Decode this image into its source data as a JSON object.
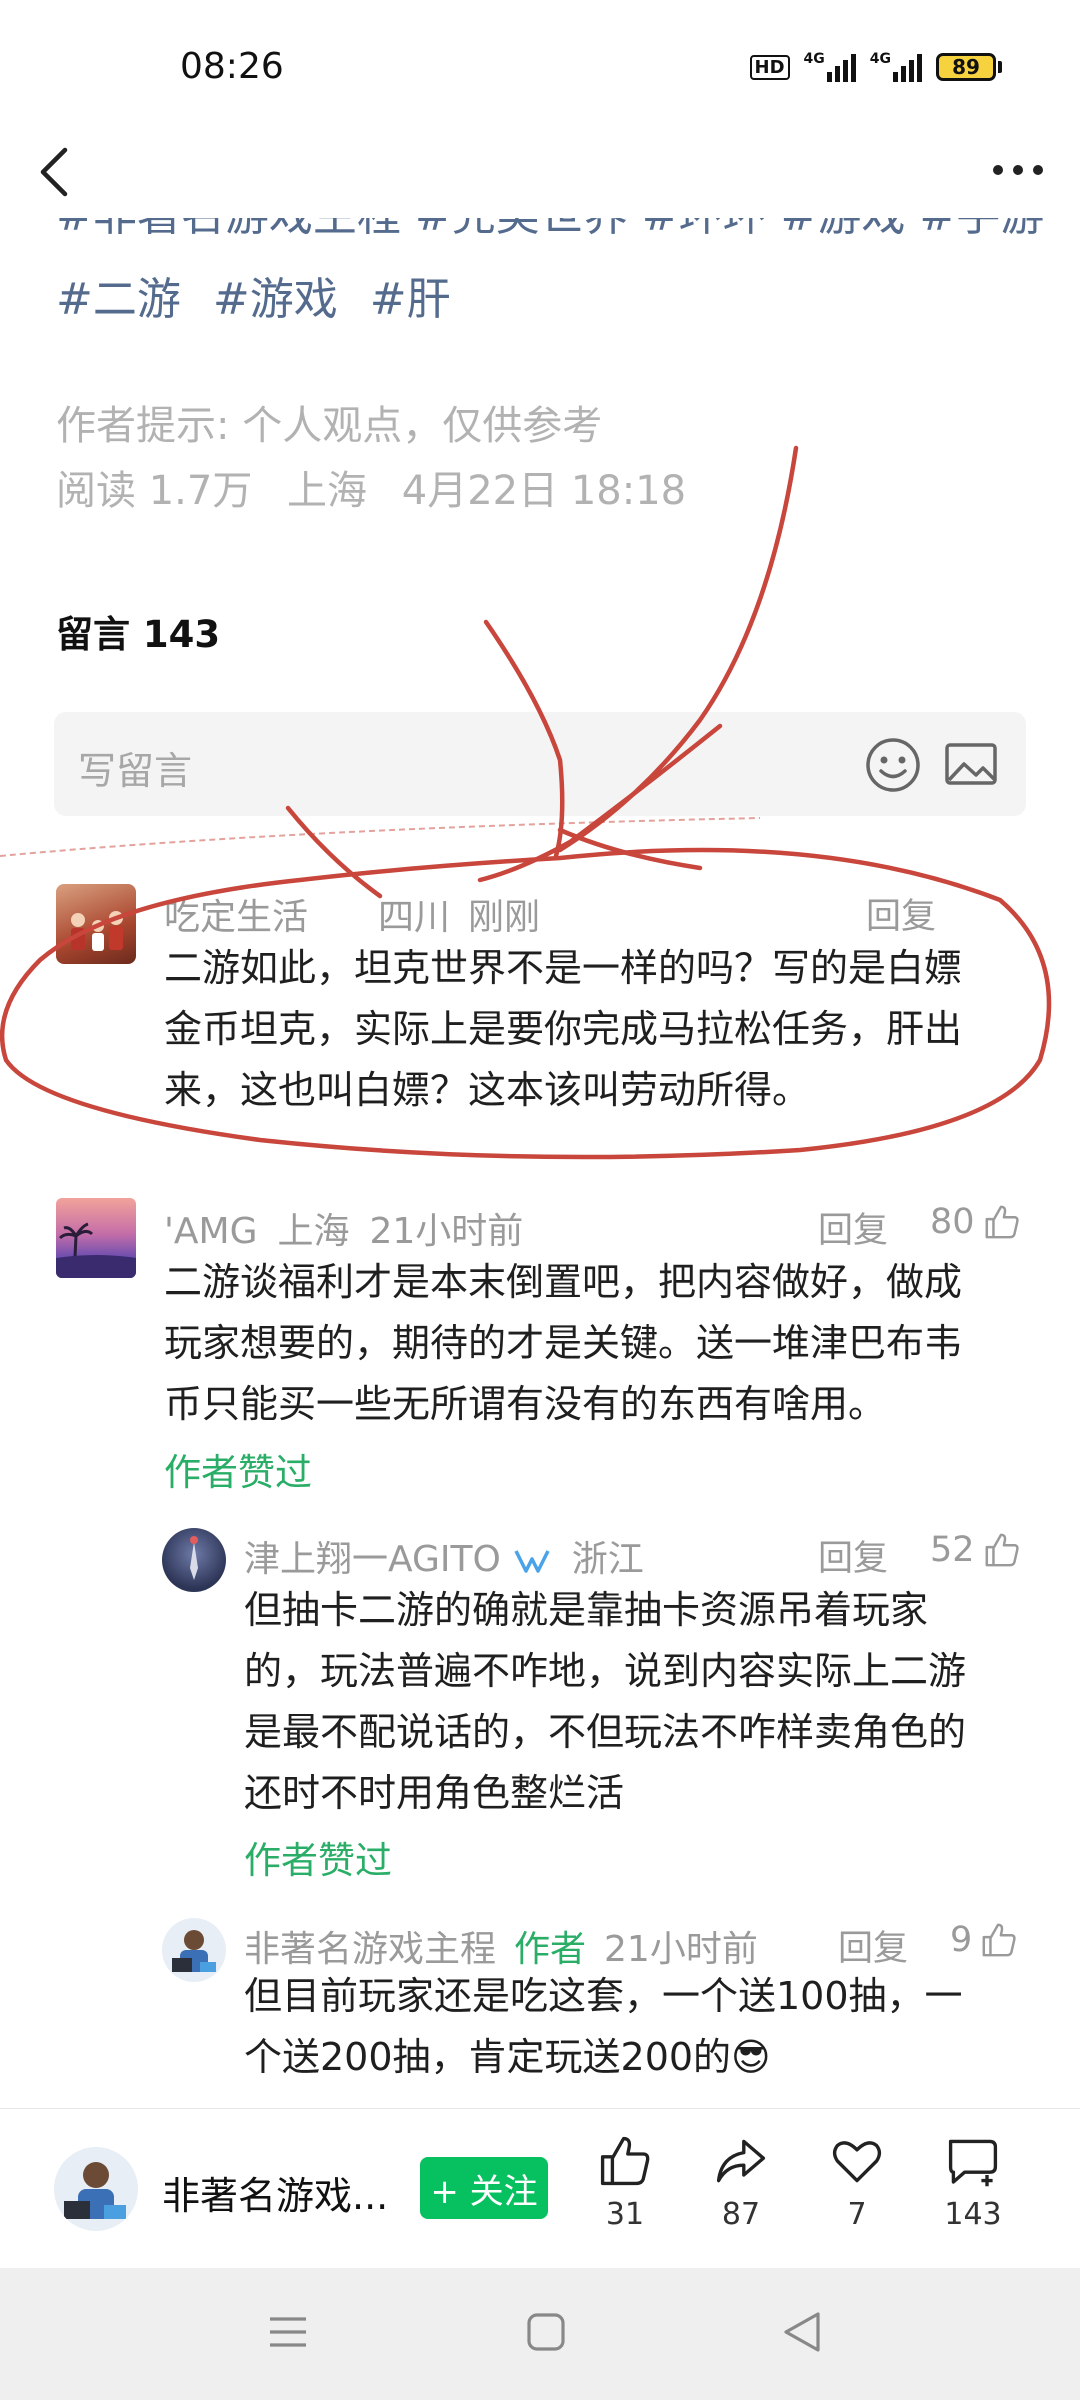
{
  "status_bar": {
    "time": "08:26",
    "hd_label": "HD",
    "net1": "4G",
    "net2": "4G",
    "battery": "89"
  },
  "article": {
    "tags_line1": "#非著名游戏主程 #完美世界 #环环 #游戏 #手游",
    "tags_line2": [
      "#二游",
      "#游戏",
      "#肝"
    ],
    "author_tip": "作者提示: 个人观点，仅供参考",
    "reads": "阅读 1.7万",
    "location": "上海",
    "date": "4月22日 18:18"
  },
  "comments_section": {
    "title": "留言 143",
    "input_placeholder": "写留言"
  },
  "comments": [
    {
      "name": "吃定生活",
      "location": "四川",
      "time": "刚刚",
      "reply_label": "回复",
      "lines": [
        "二游如此，坦克世界不是一样的吗？写的是白嫖",
        "金币坦克，实际上是要你完成马拉松任务，肝出",
        "来，这也叫白嫖？这本该叫劳动所得。"
      ]
    },
    {
      "name": "'AMG",
      "location": "上海",
      "time": "21小时前",
      "reply_label": "回复",
      "likes": "80",
      "lines": [
        "二游谈福利才是本末倒置吧，把内容做好，做成",
        "玩家想要的，期待的才是关键。送一堆津巴布韦",
        "币只能买一些无所谓有没有的东西有啥用。"
      ],
      "liked_by_author": "作者赞过"
    },
    {
      "name": "津上翔一AGITO",
      "location": "浙江",
      "reply_label": "回复",
      "likes": "52",
      "lines": [
        "但抽卡二游的确就是靠抽卡资源吊着玩家",
        "的，玩法普遍不咋地，说到内容实际上二游",
        "是最不配说话的，不但玩法不咋样卖角色的",
        "还时不时用角色整烂活"
      ],
      "liked_by_author": "作者赞过"
    },
    {
      "name": "非著名游戏主程",
      "badge": "作者",
      "time": "21小时前",
      "reply_label": "回复",
      "likes": "9",
      "lines": [
        "但目前玩家还是吃这套，一个送100抽，一",
        "个送200抽，肯定玩送200的😎"
      ]
    }
  ],
  "bottom_bar": {
    "author_name": "非著名游戏...",
    "follow_label": "+ 关注",
    "like_count": "31",
    "share_count": "87",
    "fav_count": "7",
    "comment_count": "143"
  },
  "colors": {
    "accent_green": "#07c160",
    "liked_green": "#2aae67",
    "tag_blue": "#556b8e",
    "annotation_red": "#c8463b"
  }
}
